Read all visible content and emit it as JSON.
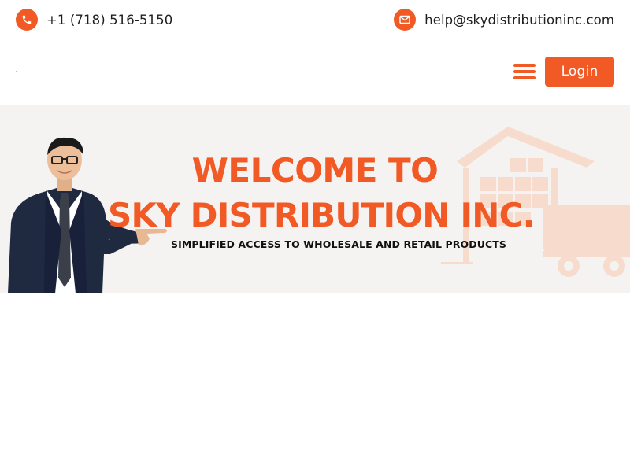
{
  "topbar": {
    "phone": "+1 (718) 516-5150",
    "email": "help@skydistributioninc.com",
    "phone_icon": "phone-icon",
    "email_icon": "envelope-icon"
  },
  "header": {
    "menu_icon": "hamburger-menu-icon",
    "login_label": "Login"
  },
  "hero": {
    "title_line1": "WELCOME TO",
    "title_line2": "SKY DISTRIBUTION INC.",
    "subtitle": "SIMPLIFIED ACCESS TO WHOLESALE AND RETAIL PRODUCTS"
  },
  "colors": {
    "accent": "#f15a24",
    "hero_bg": "#f4f3f1",
    "text": "#1f1f1f"
  }
}
